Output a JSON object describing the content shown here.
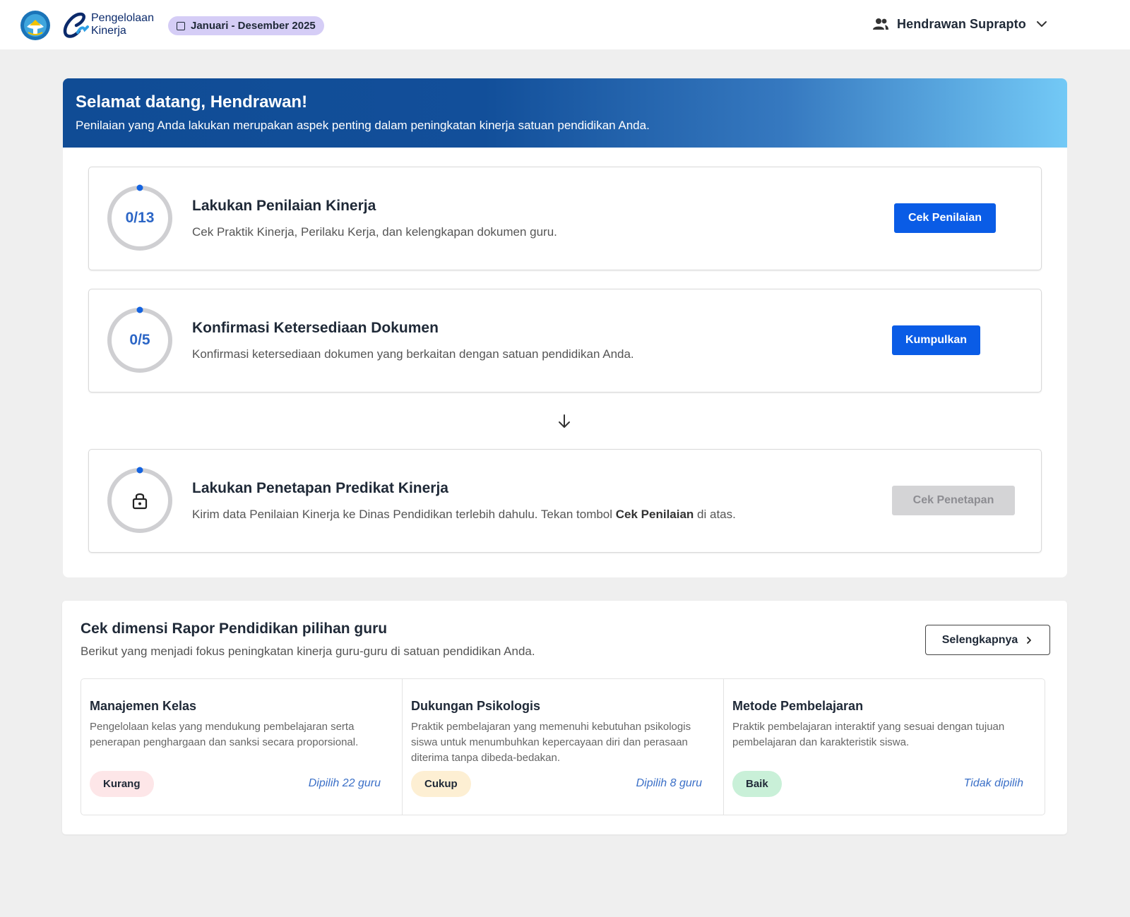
{
  "header": {
    "brand_line1": "Pengelolaan",
    "brand_line2": "Kinerja",
    "period": "Januari - Desember 2025",
    "user_name": "Hendrawan Suprapto",
    "icons": {
      "emblem": "tut-wuri-handayani-emblem",
      "brand": "e-kinerja-logo",
      "user": "users-icon",
      "dropdown": "chevron-down-icon"
    }
  },
  "welcome": {
    "title": "Selamat datang, Hendrawan!",
    "subtitle": "Penilaian yang Anda lakukan merupakan aspek penting dalam peningkatan kinerja satuan pendidikan Anda."
  },
  "tasks": [
    {
      "progress_label": "0/13",
      "progress_done": 0,
      "progress_total": 13,
      "title": "Lakukan Penilaian Kinerja",
      "description": "Cek Praktik Kinerja, Perilaku Kerja, dan kelengkapan dokumen guru.",
      "button_label": "Cek Penilaian",
      "enabled": true
    },
    {
      "progress_label": "0/5",
      "progress_done": 0,
      "progress_total": 5,
      "title": "Konfirmasi Ketersediaan Dokumen",
      "description": "Konfirmasi ketersediaan dokumen yang berkaitan dengan satuan pendidikan Anda.",
      "button_label": "Kumpulkan",
      "enabled": true
    },
    {
      "progress_icon": "lock-icon",
      "title": "Lakukan Penetapan Predikat Kinerja",
      "description_pre": "Kirim data Penilaian Kinerja ke Dinas Pendidikan terlebih dahulu. Tekan tombol ",
      "description_bold": "Cek Penilaian",
      "description_post": " di atas.",
      "button_label": "Cek Penetapan",
      "enabled": false
    }
  ],
  "rapor": {
    "title": "Cek dimensi Rapor Pendidikan pilihan guru",
    "subtitle": "Berikut yang menjadi fokus peningkatan kinerja guru-guru di satuan pendidikan Anda.",
    "more_label": "Selengkapnya",
    "dimensions": [
      {
        "name": "Manajemen Kelas",
        "description": "Pengelolaan kelas yang mendukung pembelajaran serta penerapan penghargaan dan sanksi secara proporsional.",
        "badge": "Kurang",
        "badge_color": "#fde6e8",
        "picked": "Dipilih 22 guru"
      },
      {
        "name": "Dukungan Psikologis",
        "description": "Praktik pembelajaran yang memenuhi kebutuhan psikologis siswa untuk menumbuhkan kepercayaan diri dan perasaan diterima tanpa dibeda-bedakan.",
        "badge": "Cukup",
        "badge_color": "#fdefd3",
        "picked": "Dipilih 8 guru"
      },
      {
        "name": "Metode Pembelajaran",
        "description": "Praktik pembelajaran interaktif yang sesuai dengan tujuan pembelajaran dan karakteristik siswa.",
        "badge": "Baik",
        "badge_color": "#c9f0d8",
        "picked": "Tidak dipilih"
      }
    ]
  },
  "colors": {
    "primary": "#0a5ce6",
    "banner_start": "#104c95",
    "banner_end": "#73c9f6",
    "ring_track": "#cfcfd2",
    "ring_dot": "#1463e0",
    "period_bg": "#d5cdf6"
  }
}
